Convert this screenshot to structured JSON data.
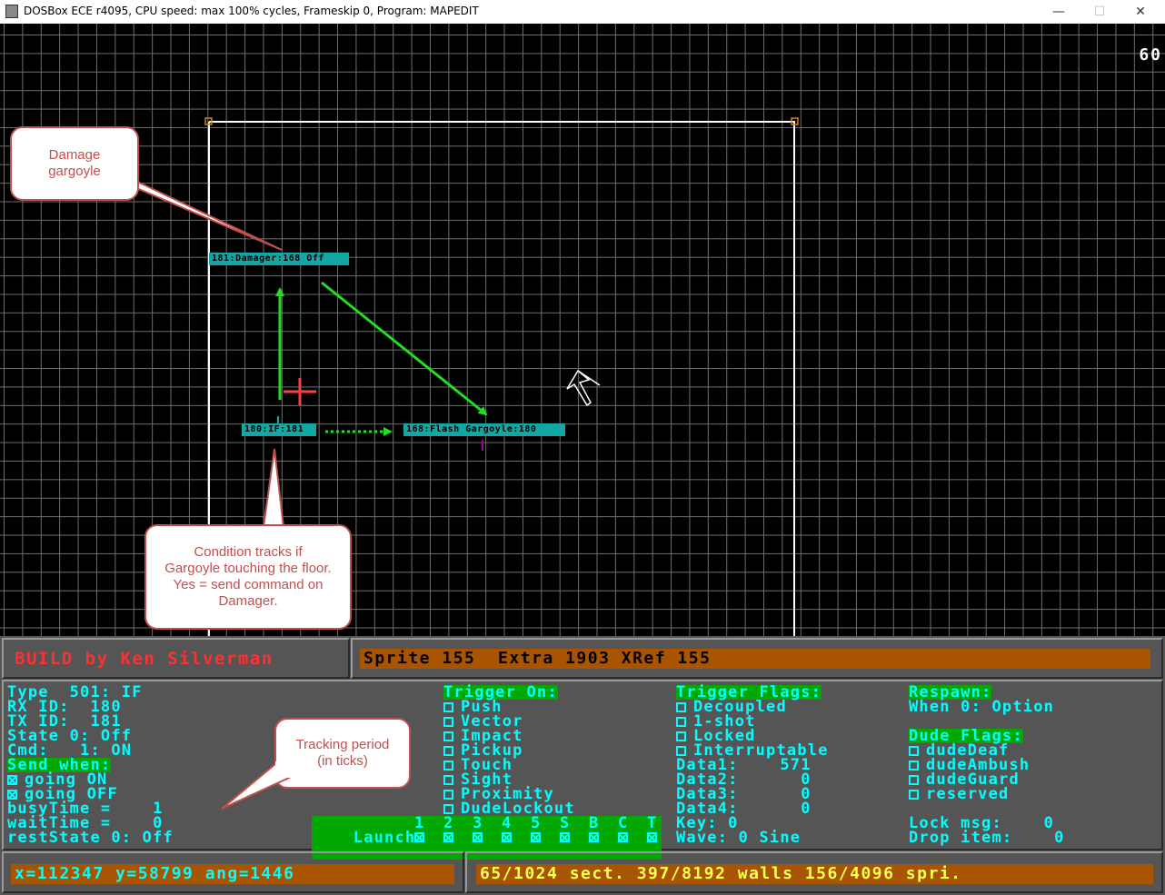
{
  "titlebar": {
    "title": "DOSBox ECE r4095, CPU speed: max 100% cycles, Frameskip  0, Program:  MAPEDIT",
    "minimize_glyph": "—",
    "maximize_glyph": "☐",
    "close_glyph": "✕"
  },
  "map": {
    "fps": "60",
    "tags": {
      "damager": "181:Damager:168 Off",
      "condition": "180:IF:181",
      "flash": "168:Flash Gargoyle:180"
    },
    "callouts": {
      "damage_gargoyle": [
        "Damage",
        "gargoyle"
      ],
      "condition": [
        "Condition tracks if",
        "Gargoyle touching the floor.",
        "Yes = send command on",
        "Damager."
      ],
      "tracking": [
        "Tracking period",
        "(in ticks)"
      ]
    },
    "colors": {
      "grid": "#6e6e6e",
      "arrow": "#22dd22",
      "tag": "#13a7a3",
      "callout": "#c0504d"
    }
  },
  "panel": {
    "build_title": "BUILD by Ken Silverman",
    "sprite_info": "Sprite 155  Extra 1903 XRef 155",
    "left": {
      "type": "Type  501: IF",
      "rx": "RX ID:  180",
      "tx": "TX ID:  181",
      "state": "State 0: Off",
      "cmd": "Cmd:   1: ON",
      "send_when": "Send when:",
      "going_on": "going ON",
      "going_off": "going OFF",
      "busy": "busyTime =    1",
      "wait": "waitTime =    0",
      "rest": "restState 0: Off"
    },
    "trigger_on": {
      "header": "Trigger On:",
      "items": [
        "Push",
        "Vector",
        "Impact",
        "Pickup",
        "Touch",
        "Sight",
        "Proximity",
        "DudeLockout"
      ]
    },
    "launch": {
      "label": "Launch",
      "slots": [
        "1",
        "2",
        "3",
        "4",
        "5",
        "S",
        "B",
        "C",
        "T"
      ]
    },
    "trigger_flags": {
      "header": "Trigger Flags:",
      "items": [
        "Decoupled",
        "1-shot",
        "Locked",
        "Interruptable"
      ],
      "data1": "Data1:    571",
      "data2": "Data2:      0",
      "data3": "Data3:      0",
      "data4": "Data4:      0",
      "key": "Key: 0",
      "wave": "Wave: 0 Sine"
    },
    "respawn": {
      "header": "Respawn:",
      "when": "When 0: Option"
    },
    "dude_flags": {
      "header": "Dude Flags:",
      "items": [
        "dudeDeaf",
        "dudeAmbush",
        "dudeGuard",
        "reserved"
      ]
    },
    "lock_msg": "Lock msg:    0",
    "drop_item": "Drop item:    0",
    "coords": "x=112347 y=58799 ang=1446",
    "stats": "65/1024 sect. 397/8192 walls 156/4096 spri."
  }
}
